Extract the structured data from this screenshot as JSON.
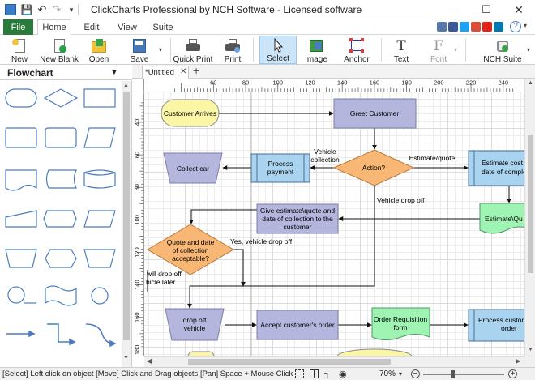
{
  "window": {
    "title": "ClickCharts Professional by NCH Software - Licensed software"
  },
  "menu": {
    "tabs": [
      "File",
      "Home",
      "Edit",
      "View",
      "Suite"
    ],
    "active": "Home"
  },
  "ribbon": {
    "new": "New",
    "new_blank": "New Blank",
    "open": "Open",
    "save": "Save",
    "quick_print": "Quick Print",
    "print": "Print",
    "select": "Select",
    "image": "Image",
    "anchor": "Anchor",
    "text": "Text",
    "font": "Font",
    "nch_suite": "NCH Suite"
  },
  "left_panel": {
    "title": "Flowchart",
    "shapes": [
      "rounded-rect",
      "diamond",
      "rectangle",
      "rounded-square",
      "rectangle-doc",
      "parallelogram",
      "document",
      "cylinder",
      "stored-data",
      "manual-input",
      "alternate-process",
      "parallelogram-2",
      "manual-operation",
      "preparation",
      "database",
      "delay-circle",
      "wave",
      "circle",
      "arrow-straight",
      "arrow-step",
      "arrow-curve"
    ]
  },
  "document": {
    "tab_label": "*Untitled"
  },
  "rulers": {
    "horizontal": [
      "60",
      "80",
      "100",
      "120",
      "140",
      "160",
      "180",
      "200",
      "220",
      "240"
    ],
    "vertical": [
      "40",
      "60",
      "80",
      "100",
      "120",
      "140",
      "160",
      "180"
    ]
  },
  "flowchart": {
    "customer_arrives": "Customer Arrives",
    "greet_customer": "Greet Customer",
    "collect_car": "Collect car",
    "process_payment": [
      "Process",
      "payment"
    ],
    "action": "Action?",
    "estimate_cost": [
      "Estimate cost",
      "date of comple"
    ],
    "estimate_quote_doc": "Estimate\\Qu",
    "give_estimate": [
      "Give estimate\\quote and",
      "date of collection to the",
      "customer"
    ],
    "quote_acceptable": [
      "Quote and date",
      "of collection",
      "acceptable?"
    ],
    "drop_off_vehicle": [
      "drop off",
      "vehicle"
    ],
    "accept_order": "Accept customer's order",
    "order_requisition": [
      "Order Requisition",
      "form"
    ],
    "process_customer_order": [
      "Process custon",
      "order"
    ],
    "lbl_vehicle_collection": [
      "Vehicle",
      "collection"
    ],
    "lbl_estimate_quote": "Estimate/quote",
    "lbl_vehicle_drop_off": "Vehicle drop off",
    "lbl_yes_drop_off": "Yes, vehicle drop off",
    "lbl_will_drop_off": [
      "will drop off",
      "hicle later"
    ]
  },
  "status": {
    "message": "[Select] Left click on object  [Move] Click and Drag objects  [Pan] Space + Mouse Click and",
    "zoom": "70%"
  },
  "colors": {
    "file_tab": "#2a7a3b",
    "accent": "#4a7bc1",
    "terminal_fill": "#fbf6a6",
    "process_fill": "#b4b6de",
    "decision_fill": "#f9b776",
    "doc_fill": "#9ff3b3",
    "subprocess_fill": "#a9d3ef"
  }
}
